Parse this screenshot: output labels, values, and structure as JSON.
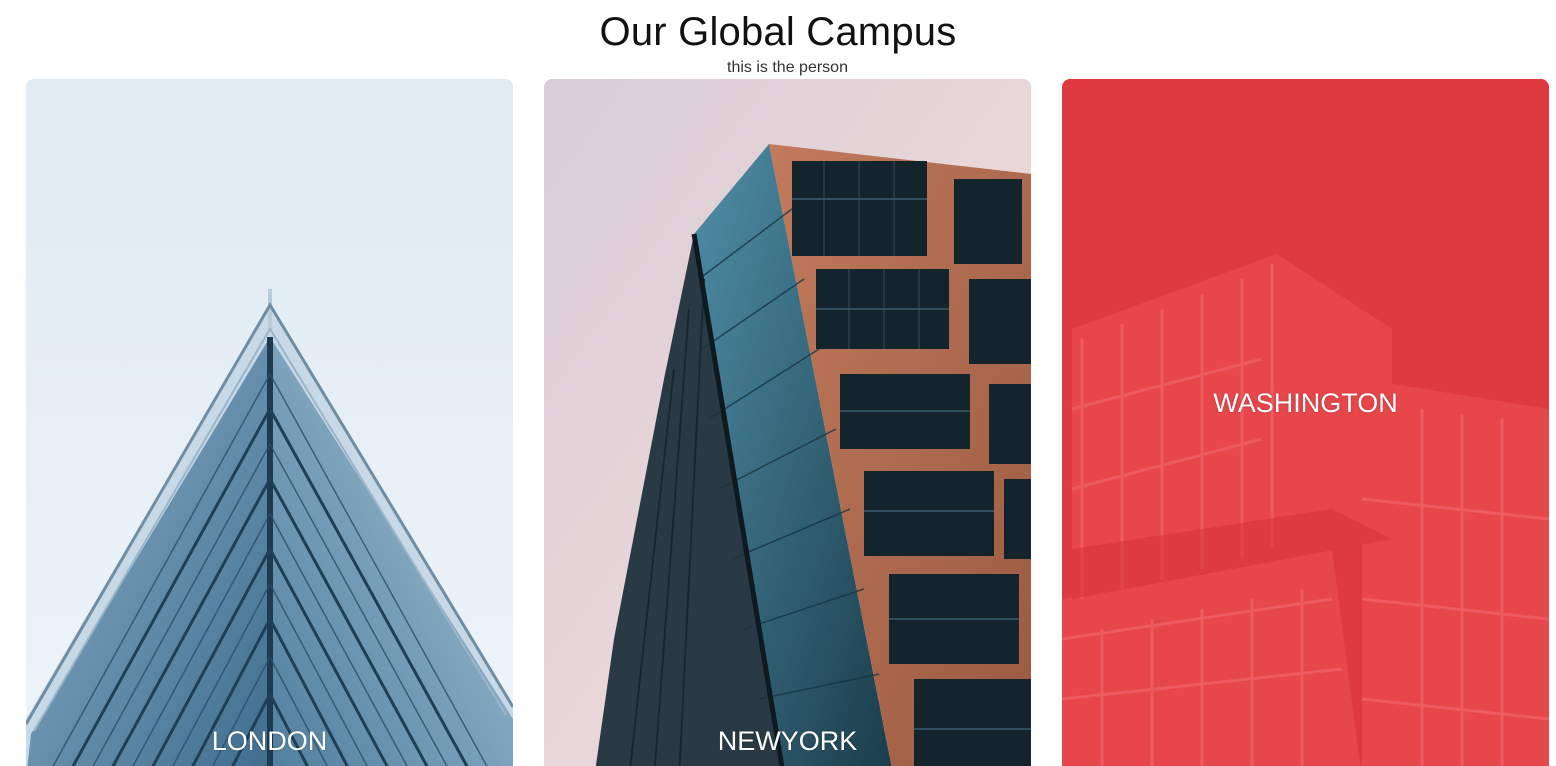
{
  "header": {
    "title": "Our Global Campus",
    "subtitle": "this is the person"
  },
  "campuses": [
    {
      "label": "LONDON",
      "overlay": "none"
    },
    {
      "label": "NEWYORK",
      "overlay": "none"
    },
    {
      "label": "WASHINGTON",
      "overlay": "#e5343a"
    }
  ],
  "colors": {
    "accent_red": "#e2383d",
    "sky_blue": "#e3eef6",
    "copper": "#b56a4e"
  }
}
